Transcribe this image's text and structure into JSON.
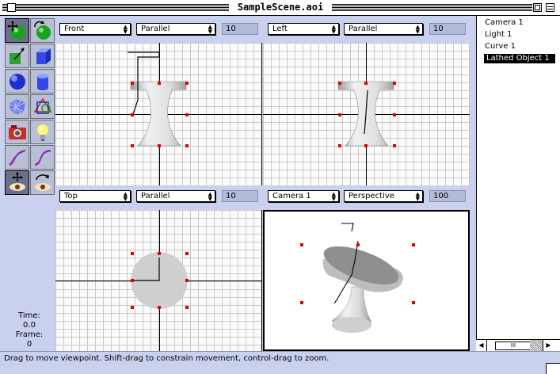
{
  "window": {
    "title": "SampleScene.aoi"
  },
  "tools": [
    {
      "name": "move-tool-icon"
    },
    {
      "name": "rotate-tool-icon"
    },
    {
      "name": "skew-tool-icon"
    },
    {
      "name": "cube-tool-icon"
    },
    {
      "name": "sphere-tool-icon"
    },
    {
      "name": "cylinder-tool-icon"
    },
    {
      "name": "polygon-mesh-tool-icon"
    },
    {
      "name": "polygon-tool-icon"
    },
    {
      "name": "camera-tool-icon"
    },
    {
      "name": "light-tool-icon"
    },
    {
      "name": "curve-tool-icon"
    },
    {
      "name": "spline-tool-icon"
    },
    {
      "name": "move-viewpoint-tool-icon"
    },
    {
      "name": "rotate-viewpoint-tool-icon"
    }
  ],
  "info": {
    "time_label": "Time:",
    "time_value": "0.0",
    "frame_label": "Frame:",
    "frame_value": "0"
  },
  "views": {
    "top_left": {
      "view": "Front",
      "projection": "Parallel",
      "scale": "10"
    },
    "top_right": {
      "view": "Left",
      "projection": "Parallel",
      "scale": "10"
    },
    "bottom_left": {
      "view": "Top",
      "projection": "Parallel",
      "scale": "10"
    },
    "bottom_right": {
      "view": "Camera 1",
      "projection": "Perspective",
      "scale": "100"
    }
  },
  "objects": [
    "Camera 1",
    "Light 1",
    "Curve 1",
    "Lathed Object 1"
  ],
  "selected_object": "Lathed Object 1",
  "scrollbar": {
    "left_arrow": "◀",
    "thumb": "III",
    "right_arrow": "▶"
  },
  "status": "Drag to move viewpoint.  Shift-drag to constrain movement, control-drag to zoom.",
  "colors": {
    "background": "#c9d1ee",
    "handle": "#e00000",
    "object": "#c8c8c8"
  }
}
